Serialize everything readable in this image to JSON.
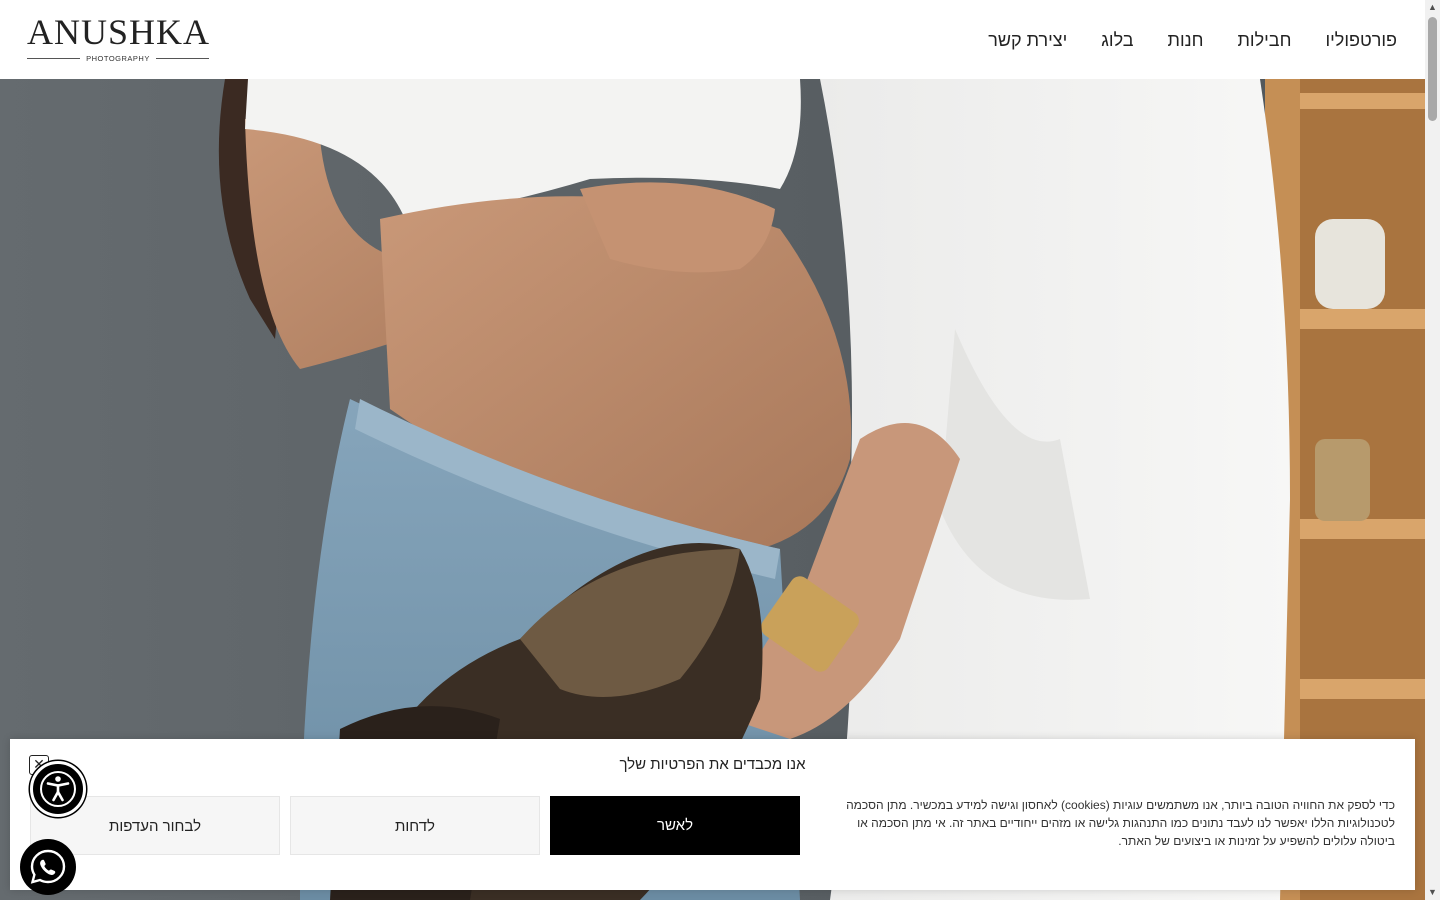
{
  "header": {
    "logo": {
      "name": "ANUSHKA",
      "tagline": "PHOTOGRAPHY"
    },
    "nav": [
      {
        "label": "פורטפוליו"
      },
      {
        "label": "חבילות"
      },
      {
        "label": "חנות"
      },
      {
        "label": "בלוג"
      },
      {
        "label": "יצירת קשר"
      }
    ]
  },
  "cookie_banner": {
    "title": "אנו מכבדים את הפרטיות שלך",
    "text": "כדי לספק את החוויה הטובה ביותר, אנו משתמשים  עוגיות (cookies) לאחסון וגישה למידע במכשיר. מתן הסכמה לטכנולוגיות הללו יאפשר לנו לעבד נתונים כמו התנהגות גלישה או מזהים ייחודיים באתר זה. אי מתן הסכמה או ביטולה עלולים להשפיע על זמינות או ביצועים של האתר.",
    "accept_label": "לאשר",
    "deny_label": "לדחות",
    "preferences_label": "לבחור העדפות",
    "close_icon": "close-icon"
  },
  "floating": {
    "accessibility_icon": "accessibility-icon",
    "whatsapp_icon": "whatsapp-icon"
  },
  "colors": {
    "accent": "#000000",
    "wall": "#5e6468",
    "shirt": "#f2f2f0",
    "denim": "#7a9ab0",
    "shelf": "#b9854c"
  }
}
